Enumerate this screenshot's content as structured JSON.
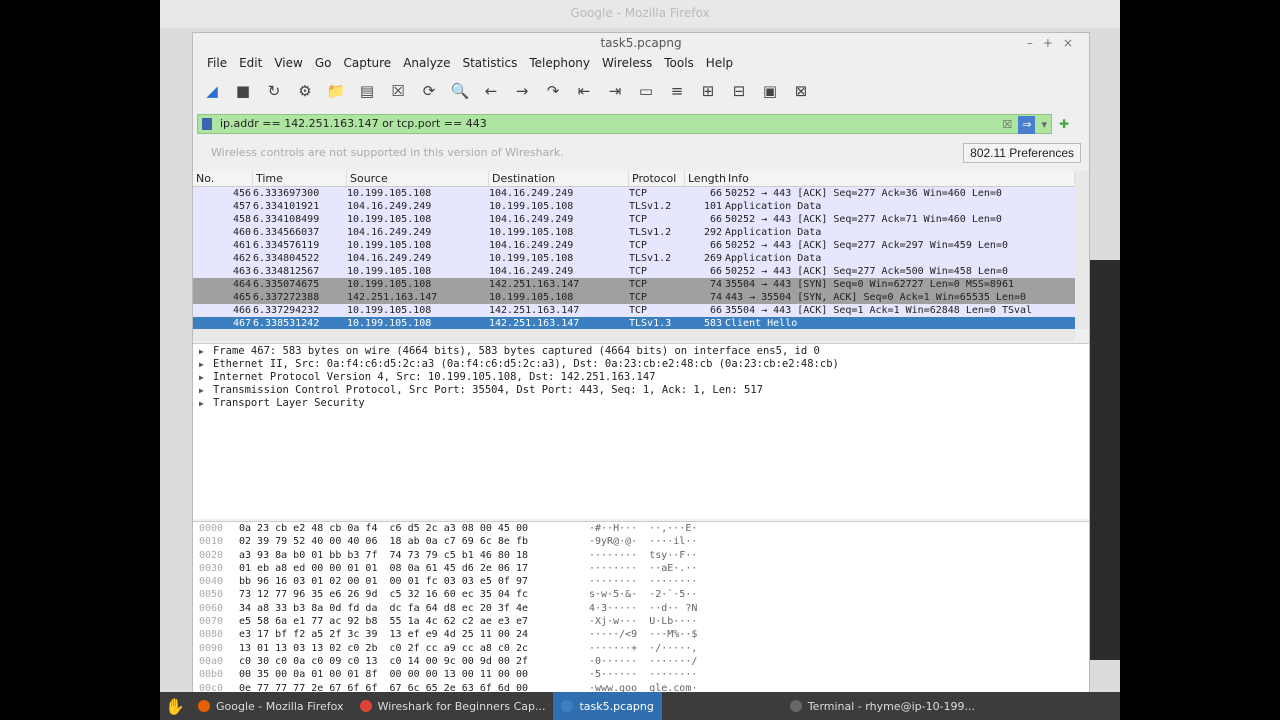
{
  "background": {
    "firefox_title": "Google - Mozilla Firefox"
  },
  "window": {
    "title": "task5.pcapng",
    "controls": [
      "–",
      "+",
      "×"
    ]
  },
  "menu": [
    "File",
    "Edit",
    "View",
    "Go",
    "Capture",
    "Analyze",
    "Statistics",
    "Telephony",
    "Wireless",
    "Tools",
    "Help"
  ],
  "toolbar_icons": [
    "shark-fin-icon",
    "stop-icon",
    "restart-icon",
    "options-gear-icon",
    "open-folder-icon",
    "save-icon",
    "close-file-icon",
    "reload-icon",
    "search-icon",
    "back-icon",
    "forward-icon",
    "jump-icon",
    "first-icon",
    "last-icon",
    "autoscroll-icon",
    "colorize-icon",
    "zoom-in-icon",
    "zoom-out-icon",
    "normal-size-icon",
    "resize-columns-icon"
  ],
  "filter": {
    "value": "ip.addr == 142.251.163.147 or tcp.port == 443"
  },
  "wireless": {
    "message": "Wireless controls are not supported in this version of Wireshark.",
    "pref_button": "802.11 Preferences"
  },
  "columns": [
    "No.",
    "Time",
    "Source",
    "Destination",
    "Protocol",
    "Length",
    "Info"
  ],
  "packets": [
    [
      "456",
      "6.333697300",
      "10.199.105.108",
      "104.16.249.249",
      "TCP",
      "66",
      "50252 → 443 [ACK] Seq=277 Ack=36 Win=460 Len=0",
      "n"
    ],
    [
      "457",
      "6.334101921",
      "104.16.249.249",
      "10.199.105.108",
      "TLSv1.2",
      "101",
      "Application Data",
      "n"
    ],
    [
      "458",
      "6.334108499",
      "10.199.105.108",
      "104.16.249.249",
      "TCP",
      "66",
      "50252 → 443 [ACK] Seq=277 Ack=71 Win=460 Len=0",
      "n"
    ],
    [
      "460",
      "6.334566037",
      "104.16.249.249",
      "10.199.105.108",
      "TLSv1.2",
      "292",
      "Application Data",
      "n"
    ],
    [
      "461",
      "6.334576119",
      "10.199.105.108",
      "104.16.249.249",
      "TCP",
      "66",
      "50252 → 443 [ACK] Seq=277 Ack=297 Win=459 Len=0",
      "n"
    ],
    [
      "462",
      "6.334804522",
      "104.16.249.249",
      "10.199.105.108",
      "TLSv1.2",
      "269",
      "Application Data",
      "n"
    ],
    [
      "463",
      "6.334812567",
      "10.199.105.108",
      "104.16.249.249",
      "TCP",
      "66",
      "50252 → 443 [ACK] Seq=277 Ack=500 Win=458 Len=0",
      "n"
    ],
    [
      "464",
      "6.335074675",
      "10.199.105.108",
      "142.251.163.147",
      "TCP",
      "74",
      "35504 → 443 [SYN] Seq=0 Win=62727 Len=0 MSS=8961",
      "g"
    ],
    [
      "465",
      "6.337272388",
      "142.251.163.147",
      "10.199.105.108",
      "TCP",
      "74",
      "443 → 35504 [SYN, ACK] Seq=0 Ack=1 Win=65535 Len=0",
      "g"
    ],
    [
      "466",
      "6.337294232",
      "10.199.105.108",
      "142.251.163.147",
      "TCP",
      "66",
      "35504 → 443 [ACK] Seq=1 Ack=1 Win=62848 Len=0 TSval",
      "n"
    ],
    [
      "467",
      "6.338531242",
      "10.199.105.108",
      "142.251.163.147",
      "TLSv1.3",
      "583",
      "Client Hello",
      "s"
    ]
  ],
  "details": [
    "Frame 467: 583 bytes on wire (4664 bits), 583 bytes captured (4664 bits) on interface ens5, id 0",
    "Ethernet II, Src: 0a:f4:c6:d5:2c:a3 (0a:f4:c6:d5:2c:a3), Dst: 0a:23:cb:e2:48:cb (0a:23:cb:e2:48:cb)",
    "Internet Protocol Version 4, Src: 10.199.105.108, Dst: 142.251.163.147",
    "Transmission Control Protocol, Src Port: 35504, Dst Port: 443, Seq: 1, Ack: 1, Len: 517",
    "Transport Layer Security"
  ],
  "bytes": [
    [
      "0000",
      "0a 23 cb e2 48 cb 0a f4  c6 d5 2c a3 08 00 45 00",
      "·#··H···  ··,···E·"
    ],
    [
      "0010",
      "02 39 79 52 40 00 40 06  18 ab 0a c7 69 6c 8e fb",
      "·9yR@·@·  ····il··"
    ],
    [
      "0020",
      "a3 93 8a b0 01 bb b3 7f  74 73 79 c5 b1 46 80 18",
      "········  tsy··F··"
    ],
    [
      "0030",
      "01 eb a8 ed 00 00 01 01  08 0a 61 45 d6 2e 06 17",
      "········  ··aE·.··"
    ],
    [
      "0040",
      "bb 96 16 03 01 02 00 01  00 01 fc 03 03 e5 0f 97",
      "········  ········"
    ],
    [
      "0050",
      "73 12 77 96 35 e6 26 9d  c5 32 16 60 ec 35 04 fc",
      "s·w·5·&·  ·2·`·5··"
    ],
    [
      "0060",
      "34 a8 33 b3 8a 0d fd da  dc fa 64 d8 ec 20 3f 4e",
      "4·3·····  ··d·· ?N"
    ],
    [
      "0070",
      "e5 58 6a e1 77 ac 92 b8  55 1a 4c 62 c2 ae e3 e7",
      "·Xj·w···  U·Lb····"
    ],
    [
      "0080",
      "e3 17 bf f2 a5 2f 3c 39  13 ef e9 4d 25 11 00 24",
      "·····/<9  ···M%··$"
    ],
    [
      "0090",
      "13 01 13 03 13 02 c0 2b  c0 2f cc a9 cc a8 c0 2c",
      "·······+  ·/·····,"
    ],
    [
      "00a0",
      "c0 30 c0 0a c0 09 c0 13  c0 14 00 9c 00 9d 00 2f",
      "·0······  ·······/"
    ],
    [
      "00b0",
      "00 35 00 0a 01 00 01 8f  00 00 00 13 00 11 00 00",
      "·5······  ········"
    ],
    [
      "00c0",
      "0e 77 77 77 2e 67 6f 6f  67 6c 65 2e 63 6f 6d 00",
      "·www.goo  gle.com·"
    ]
  ],
  "taskbar": [
    "Google - Mozilla Firefox",
    "Wireshark for Beginners Cap...",
    "task5.pcapng",
    "Terminal - rhyme@ip-10-199..."
  ],
  "colors": {
    "selected": "#3b7fc0",
    "tcp_row": "#e7e6ff",
    "syn_row": "#a0a0a0",
    "filter_ok": "#aee5a0"
  }
}
